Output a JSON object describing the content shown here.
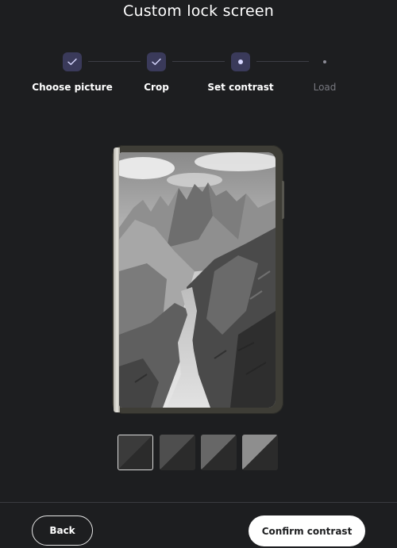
{
  "page": {
    "title": "Custom lock screen"
  },
  "stepper": {
    "steps": [
      {
        "label": "Choose picture",
        "state": "completed"
      },
      {
        "label": "Crop",
        "state": "completed"
      },
      {
        "label": "Set contrast",
        "state": "current"
      },
      {
        "label": "Load",
        "state": "upcoming"
      }
    ]
  },
  "preview": {
    "image_description_icon": "mountain-photo",
    "contrast_options": [
      {
        "id": "contrast-1",
        "selected": true
      },
      {
        "id": "contrast-2",
        "selected": false
      },
      {
        "id": "contrast-3",
        "selected": false
      },
      {
        "id": "contrast-4",
        "selected": false
      }
    ]
  },
  "footer": {
    "back_label": "Back",
    "confirm_label": "Confirm contrast"
  },
  "colors": {
    "background": "#1d1e20",
    "step_active": "#3a3a5a",
    "primary_button": "#ffffff"
  }
}
